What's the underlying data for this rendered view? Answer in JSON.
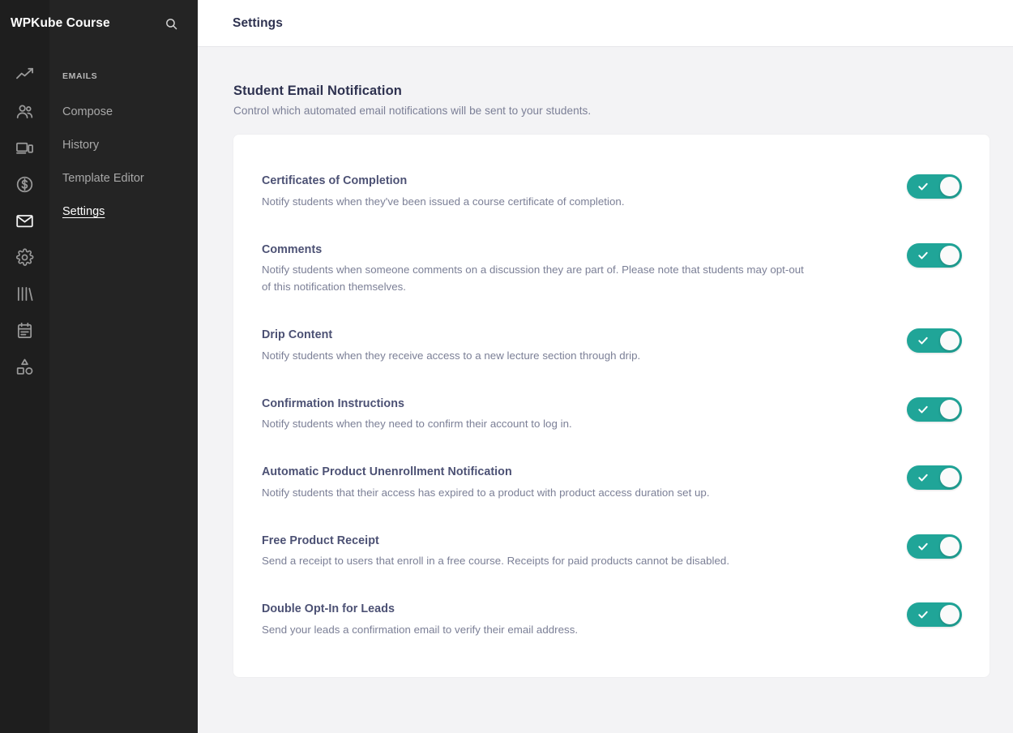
{
  "brand": {
    "title": "WPKube Course",
    "search_icon": "search-icon"
  },
  "icon_rail": {
    "items": [
      {
        "name": "analytics-icon",
        "label": "Analytics",
        "active": false
      },
      {
        "name": "students-icon",
        "label": "Students",
        "active": false
      },
      {
        "name": "devices-icon",
        "label": "Site",
        "active": false
      },
      {
        "name": "revenue-icon",
        "label": "Revenue",
        "active": false
      },
      {
        "name": "emails-icon",
        "label": "Emails",
        "active": true
      },
      {
        "name": "settings-gear-icon",
        "label": "Settings",
        "active": false
      },
      {
        "name": "library-icon",
        "label": "Library",
        "active": false
      },
      {
        "name": "calendar-icon",
        "label": "Calendar",
        "active": false
      },
      {
        "name": "shapes-icon",
        "label": "Design",
        "active": false
      }
    ]
  },
  "sidebar": {
    "header": "EMAILS",
    "items": [
      {
        "label": "Compose",
        "active": false
      },
      {
        "label": "History",
        "active": false
      },
      {
        "label": "Template Editor",
        "active": false
      },
      {
        "label": "Settings",
        "active": true
      }
    ]
  },
  "topbar": {
    "title": "Settings"
  },
  "section": {
    "title": "Student Email Notification",
    "subtitle": "Control which automated email notifications will be sent to your students."
  },
  "colors": {
    "toggle_on": "#20a598",
    "heading": "#2e3250",
    "body_text": "#7b7f96",
    "rail_bg": "#1e1e1e",
    "sidebar_bg": "#242424",
    "page_bg": "#f3f3f5"
  },
  "settings": [
    {
      "name": "Certificates of Completion",
      "description": "Notify students when they've been issued a course certificate of completion.",
      "enabled": true,
      "toggle_state": "on"
    },
    {
      "name": "Comments",
      "description": "Notify students when someone comments on a discussion they are part of. Please note that students may opt-out of this notification themselves.",
      "enabled": true,
      "toggle_state": "on"
    },
    {
      "name": "Drip Content",
      "description": "Notify students when they receive access to a new lecture section through drip.",
      "enabled": true,
      "toggle_state": "on"
    },
    {
      "name": "Confirmation Instructions",
      "description": "Notify students when they need to confirm their account to log in.",
      "enabled": true,
      "toggle_state": "on"
    },
    {
      "name": "Automatic Product Unenrollment Notification",
      "description": "Notify students that their access has expired to a product with product access duration set up.",
      "enabled": true,
      "toggle_state": "on"
    },
    {
      "name": "Free Product Receipt",
      "description": "Send a receipt to users that enroll in a free course. Receipts for paid products cannot be disabled.",
      "enabled": true,
      "toggle_state": "on"
    },
    {
      "name": "Double Opt-In for Leads",
      "description": "Send your leads a confirmation email to verify their email address.",
      "enabled": true,
      "toggle_state": "on"
    }
  ]
}
